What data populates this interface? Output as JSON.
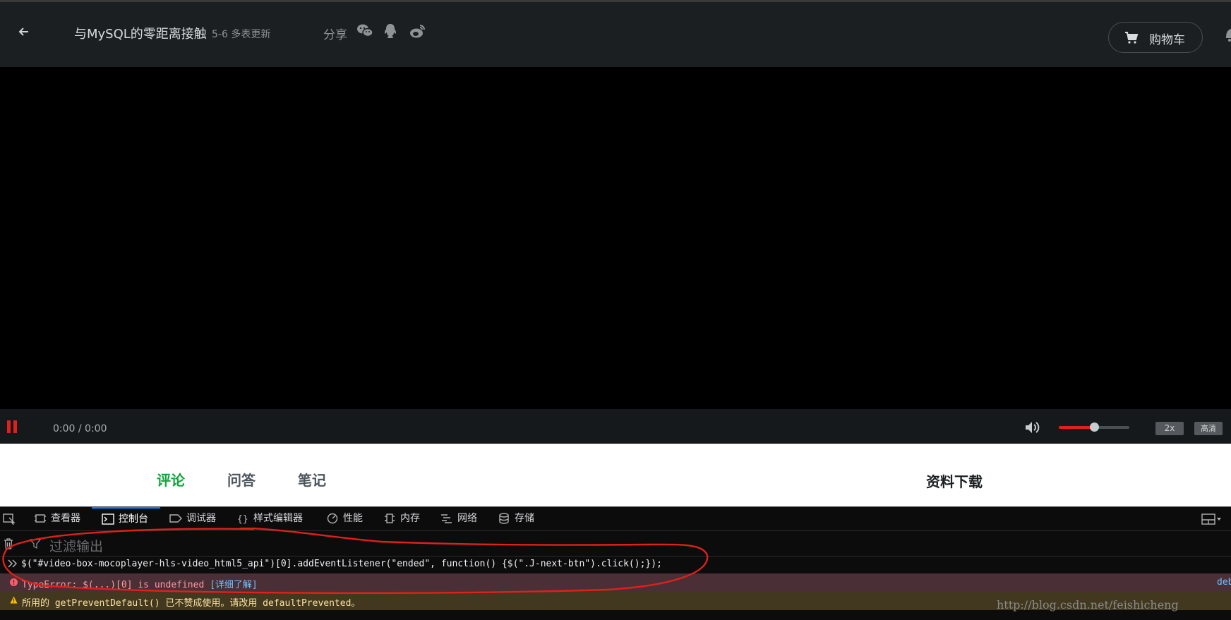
{
  "header": {
    "back_icon": "arrow-left-icon",
    "course_title": "与MySQL的零距离接触",
    "chapter": "5-6 多表更新",
    "share_label": "分享",
    "share_icons": [
      "wechat-icon",
      "qq-icon",
      "weibo-icon"
    ],
    "cart_label": "购物车",
    "cart_icon": "cart-icon",
    "bell_icon": "bell-icon"
  },
  "player": {
    "state": "paused",
    "time": "0:00 / 0:00",
    "volume_level": 0.5,
    "speed_label": "2x",
    "quality_label": "高清",
    "accent_color": "#e0201a"
  },
  "course_tabs": {
    "items": [
      {
        "label": "评论",
        "active": true
      },
      {
        "label": "问答",
        "active": false
      },
      {
        "label": "笔记",
        "active": false
      }
    ],
    "downloads_label": "资料下载",
    "active_color": "#14a33c"
  },
  "devtools": {
    "tabs": [
      {
        "label": "查看器",
        "icon": "inspector-icon",
        "active": false
      },
      {
        "label": "控制台",
        "icon": "console-icon",
        "active": true
      },
      {
        "label": "调试器",
        "icon": "debugger-icon",
        "active": false
      },
      {
        "label": "样式编辑器",
        "icon": "style-editor-icon",
        "active": false
      },
      {
        "label": "性能",
        "icon": "performance-icon",
        "active": false
      },
      {
        "label": "内存",
        "icon": "memory-icon",
        "active": false
      },
      {
        "label": "网络",
        "icon": "network-icon",
        "active": false
      },
      {
        "label": "存储",
        "icon": "storage-icon",
        "active": false
      }
    ],
    "filter_placeholder": "过滤输出",
    "console": {
      "command": "$(\"#video-box-mocoplayer-hls-video_html5_api\")[0].addEventListener(\"ended\", function() {$(\".J-next-btn\").click();});",
      "error": "TypeError: $(...)[0] is undefined",
      "error_link": "[详细了解]",
      "error_source": "deb",
      "warning": "所用的 getPreventDefault() 已不赞成使用。请改用 defaultPrevented。"
    }
  },
  "watermark": "http://blog.csdn.net/feishicheng"
}
